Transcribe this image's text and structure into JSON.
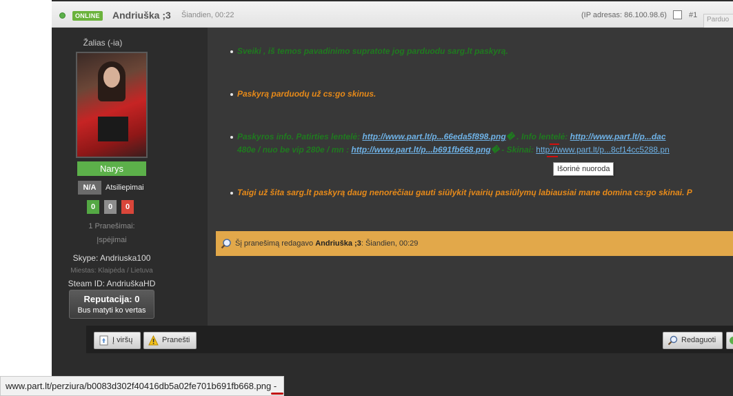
{
  "header": {
    "status_badge": "ONLINE",
    "author": "Andriuška ;3",
    "date": "Šiandien, 00:22",
    "ip": "(IP adresas: 86.100.98.6)",
    "post_number": "#1",
    "image_placeholder": "Parduo"
  },
  "user": {
    "title": "Žalias (-ia)",
    "rank": "Narys",
    "feedback_badge": "N/A",
    "feedback_label": "Atsiliepimai",
    "scores": [
      "0",
      "0",
      "0"
    ],
    "posts": "1 Pranešimai:",
    "warnings": "Įspėjimai",
    "skype": "Skype: Andriuska100",
    "city": "Miestas: Klaipėda / Lietuva",
    "steam": "Steam ID: AndriuškaHD",
    "reputation": "Reputacija: 0",
    "reputation_sub": "Bus matyti ko vertas"
  },
  "post": {
    "line1": "Sveiki , iš temos pavadinimo supratote jog parduodu sarg.lt paskyrą.",
    "line2": "Paskyrą parduodų už cs:go skinus.",
    "line3_prefix": "Paskyros info. Patirties lentelė: ",
    "line3_link1": "http://www.part.lt/p...66eda5f898.png",
    "line3_mid": "� . Info lentelė: ",
    "line3_link2": "http://www.part.lt/p...dac",
    "line4_prefix": "480e / nuo be vip 280e / mn : ",
    "line4_link": "http://www.part.lt/p...b691fb668.png",
    "line4_mid": "� - Skinai: ",
    "line4_link2": "http://www.part.lt/p...8cf14cc5288.pn",
    "line5": "Taigi už šita sarg.lt paskyrą daug nenorėčiau gauti siūlykit įvairių pasiūlymų labiausiai mane domina cs:go skinai. P",
    "tooltip": "Išorinė nuoroda"
  },
  "edit": {
    "prefix": "Šį pranešimą redagavo ",
    "editor": "Andriuška ;3",
    "suffix": ": Šiandien, 00:29"
  },
  "footer": {
    "top_label": "Į viršų",
    "report_label": "Pranešti",
    "edit_label": "Redaguoti"
  },
  "statusbar": {
    "url": "www.part.lt/perziura/b0083d302f40416db5a02fe701b691fb668.png -"
  },
  "colors": {
    "green_text": "#1f7a1f",
    "orange_text": "#e78a19",
    "link": "#6fb2e6",
    "rank_green": "#5cb04a",
    "edit_bar": "#e2a84a"
  }
}
